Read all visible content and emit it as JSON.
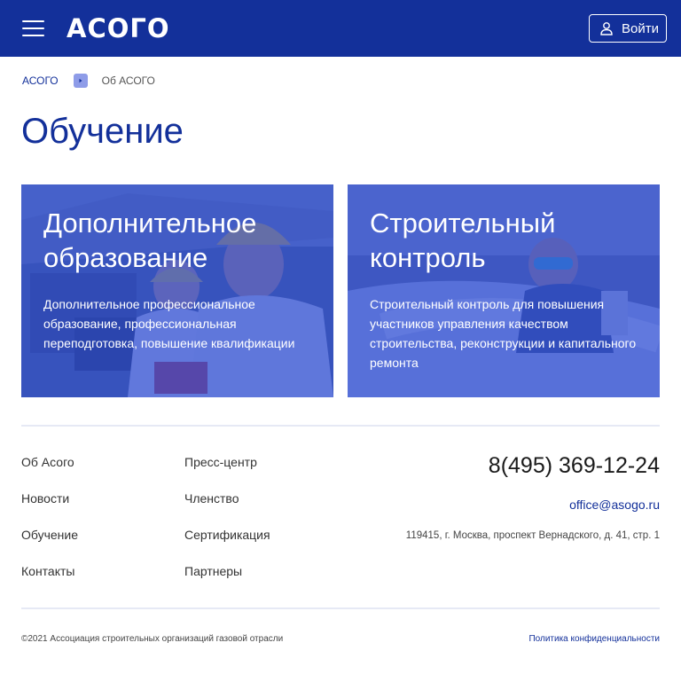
{
  "header": {
    "logo": "АСОГО",
    "login_label": "Войти",
    "bg_color": "#13309a"
  },
  "breadcrumb": {
    "home": "АСОГО",
    "current": "Об АСОГО"
  },
  "page_title": "Обучение",
  "cards": [
    {
      "title": "Дополнительное образование",
      "text": "Дополнительное профессиональное образование, профессиональная переподготовка, повышение квалификации",
      "image": "workers-in-hard-hats-photo"
    },
    {
      "title": "Строительный контроль",
      "text": "Строительный контроль для повышения участников  управления качеством строительства, реконструкции и капитального ремонта",
      "image": "welder-on-pipeline-photo"
    }
  ],
  "footer": {
    "col1": [
      "Об Асого",
      "Новости",
      "Обучение",
      "Контакты"
    ],
    "col2": [
      "Пресс-центр",
      "Членство",
      "Сертификация",
      "Партнеры"
    ],
    "phone": "8(495) 369-12-24",
    "email": "office@asogo.ru",
    "address": "119415, г. Москва, проспект Вернадского, д. 41, стр. 1",
    "copyright": "©2021 Ассоциация строительных организаций газовой отрасли",
    "privacy": "Политика конфиденциальности"
  }
}
